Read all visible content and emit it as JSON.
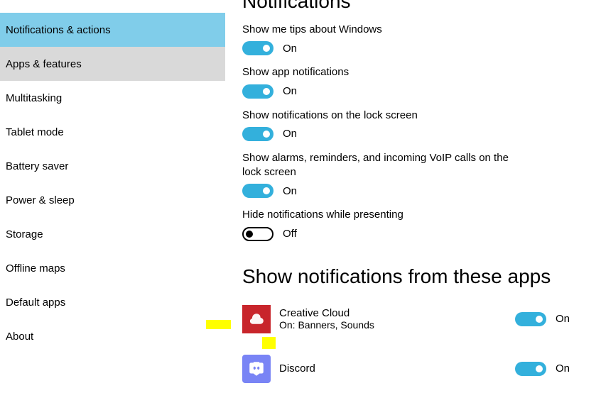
{
  "sidebar": {
    "items": [
      {
        "label": "Notifications & actions",
        "state": "selected"
      },
      {
        "label": "Apps & features",
        "state": "hover"
      },
      {
        "label": "Multitasking",
        "state": ""
      },
      {
        "label": "Tablet mode",
        "state": ""
      },
      {
        "label": "Battery saver",
        "state": ""
      },
      {
        "label": "Power & sleep",
        "state": ""
      },
      {
        "label": "Storage",
        "state": ""
      },
      {
        "label": "Offline maps",
        "state": ""
      },
      {
        "label": "Default apps",
        "state": ""
      },
      {
        "label": "About",
        "state": ""
      }
    ]
  },
  "page": {
    "title": "Notifications"
  },
  "settings": {
    "tips": {
      "label": "Show me tips about Windows",
      "state": "On",
      "on": true
    },
    "appnoti": {
      "label": "Show app notifications",
      "state": "On",
      "on": true
    },
    "lock": {
      "label": "Show notifications on the lock screen",
      "state": "On",
      "on": true
    },
    "alarms": {
      "label": "Show alarms, reminders, and incoming VoIP calls on the lock screen",
      "state": "On",
      "on": true
    },
    "hide": {
      "label": "Hide notifications while presenting",
      "state": "Off",
      "on": false
    }
  },
  "appsSection": {
    "title": "Show notifications from these apps"
  },
  "apps": {
    "cc": {
      "name": "Creative Cloud",
      "sub": "On: Banners, Sounds",
      "state": "On"
    },
    "discord": {
      "name": "Discord",
      "sub": "",
      "state": "On"
    }
  }
}
